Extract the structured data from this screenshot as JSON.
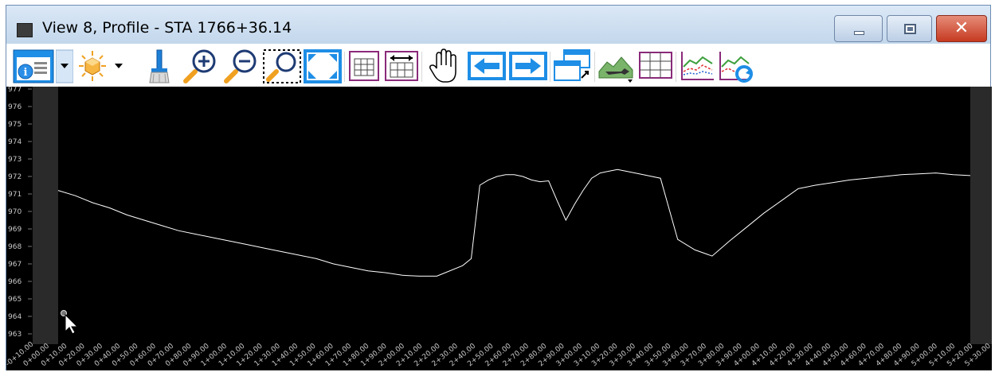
{
  "window": {
    "title": "View 8, Profile - STA 1766+36.14",
    "minimize_icon": "minimize-icon",
    "maximize_icon": "maximize-icon",
    "close_icon": "close-icon",
    "close_glyph": "✕"
  },
  "toolbar": {
    "items": [
      {
        "name": "view-attributes-button",
        "icon": "view-attributes-icon"
      },
      {
        "name": "view-attributes-dropdown",
        "icon": "chevron-down-icon"
      },
      {
        "name": "display-style-button",
        "icon": "display-style-icon"
      },
      {
        "name": "display-style-dropdown",
        "icon": "chevron-down-icon"
      },
      {
        "name": "update-view-button",
        "icon": "brush-icon"
      },
      {
        "name": "zoom-in-button",
        "icon": "zoom-in-icon"
      },
      {
        "name": "zoom-out-button",
        "icon": "zoom-out-icon"
      },
      {
        "name": "window-area-button",
        "icon": "window-area-icon"
      },
      {
        "name": "fit-view-button",
        "icon": "fit-view-icon"
      },
      {
        "name": "exaggeration-button",
        "icon": "grid-icon"
      },
      {
        "name": "horizontal-scale-button",
        "icon": "horizontal-scale-icon"
      },
      {
        "name": "pan-view-button",
        "icon": "hand-icon"
      },
      {
        "name": "previous-view-button",
        "icon": "arrow-left-icon"
      },
      {
        "name": "next-view-button",
        "icon": "arrow-right-icon"
      },
      {
        "name": "copy-view-button",
        "icon": "copy-view-icon"
      },
      {
        "name": "terrain-button",
        "icon": "terrain-icon"
      },
      {
        "name": "grid-toggle-button",
        "icon": "grid-toggle-icon"
      },
      {
        "name": "profile-display-button",
        "icon": "profile-chart-icon"
      },
      {
        "name": "refresh-profile-button",
        "icon": "refresh-profile-icon"
      }
    ]
  },
  "colors": {
    "plot_background": "#000000",
    "profile_line": "#ffffff",
    "label_color": "#c8c8c8",
    "side_band": "#2a2a2a",
    "accent_blue": "#1e8ee6"
  },
  "chart_data": {
    "type": "line",
    "title": "",
    "xlabel": "",
    "ylabel": "",
    "ylim": [
      963,
      977
    ],
    "y_ticks": [
      963,
      964,
      965,
      966,
      967,
      968,
      969,
      970,
      971,
      972,
      973,
      974,
      975,
      976,
      977
    ],
    "x_ticks": [
      "-0+10.00",
      "0+00.00",
      "0+10.00",
      "0+20.00",
      "0+30.00",
      "0+40.00",
      "0+50.00",
      "0+60.00",
      "0+70.00",
      "0+80.00",
      "0+90.00",
      "1+00.00",
      "1+10.00",
      "1+20.00",
      "1+30.00",
      "1+40.00",
      "1+50.00",
      "1+60.00",
      "1+70.00",
      "1+80.00",
      "1+90.00",
      "2+00.00",
      "2+10.00",
      "2+20.00",
      "2+30.00",
      "2+40.00",
      "2+50.00",
      "2+60.00",
      "2+70.00",
      "2+80.00",
      "2+90.00",
      "3+00.00",
      "3+10.00",
      "3+20.00",
      "3+30.00",
      "3+40.00",
      "3+50.00",
      "3+60.00",
      "3+70.00",
      "3+80.00",
      "3+90.00",
      "4+00.00",
      "4+10.00",
      "4+20.00",
      "4+30.00",
      "4+40.00",
      "4+50.00",
      "4+60.00",
      "4+70.00",
      "4+80.00",
      "4+90.00",
      "5+00.00",
      "5+10.00",
      "5+20.00",
      "5+30.00"
    ],
    "xlim": [
      -10,
      530
    ],
    "grid": false,
    "series": [
      {
        "x": [
          0,
          10,
          20,
          30,
          40,
          50,
          60,
          70,
          80,
          90,
          100,
          110,
          120,
          130,
          140,
          150,
          160,
          170,
          180,
          190,
          200,
          210,
          220,
          225,
          235,
          240,
          245,
          250,
          255,
          260,
          265,
          270,
          275,
          280,
          285,
          290,
          295,
          300,
          305,
          310,
          315,
          320,
          325,
          330,
          340,
          350,
          360,
          370,
          380,
          390,
          400,
          410,
          420,
          430,
          440,
          450,
          460,
          470,
          480,
          490,
          500,
          510,
          520,
          530
        ],
        "y": [
          971.2,
          970.9,
          970.5,
          970.2,
          969.8,
          969.5,
          969.2,
          968.9,
          968.7,
          968.5,
          968.3,
          968.1,
          967.9,
          967.7,
          967.5,
          967.3,
          967.0,
          966.8,
          966.6,
          966.5,
          966.35,
          966.3,
          966.3,
          966.5,
          966.9,
          967.3,
          971.5,
          971.8,
          972.0,
          972.1,
          972.1,
          972.0,
          971.8,
          971.7,
          971.75,
          970.6,
          969.5,
          970.4,
          971.2,
          971.9,
          972.2,
          972.3,
          972.4,
          972.3,
          972.1,
          971.9,
          968.4,
          967.8,
          967.45,
          968.3,
          969.1,
          969.9,
          970.6,
          971.3,
          971.5,
          971.65,
          971.8,
          971.9,
          972.0,
          972.1,
          972.15,
          972.2,
          972.1,
          972.05
        ]
      }
    ]
  }
}
